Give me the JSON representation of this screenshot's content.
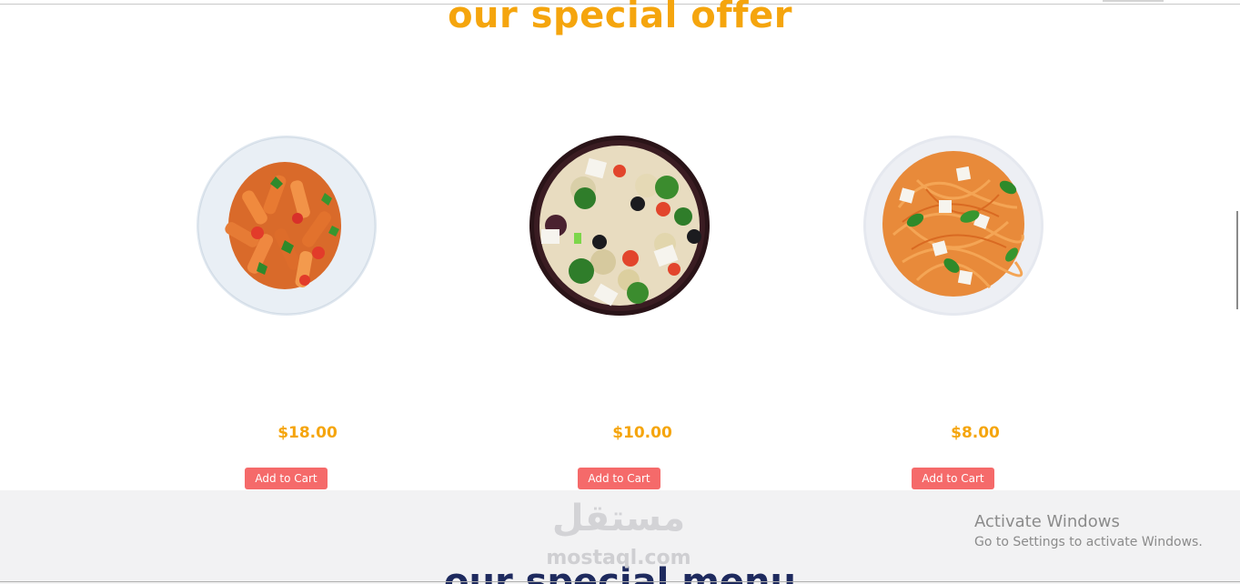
{
  "section": {
    "title": "our special offer"
  },
  "products": [
    {
      "image": "penne-pasta-plate",
      "price": "$18.00",
      "button_label": "Add to Cart"
    },
    {
      "image": "pasta-salad-bowl",
      "price": "$10.00",
      "button_label": "Add to Cart"
    },
    {
      "image": "spaghetti-plate",
      "price": "$8.00",
      "button_label": "Add to Cart"
    }
  ],
  "next_section": {
    "title": "our special menu"
  },
  "watermark": {
    "arabic": "مستقل",
    "latin": "mostaql.com"
  },
  "windows_notice": {
    "title": "Activate Windows",
    "subtitle": "Go to Settings to activate Windows."
  },
  "colors": {
    "accent": "#f5a50d",
    "button": "#f56a6a",
    "menu_title": "#1e2a5e",
    "band": "#f2f2f3"
  }
}
